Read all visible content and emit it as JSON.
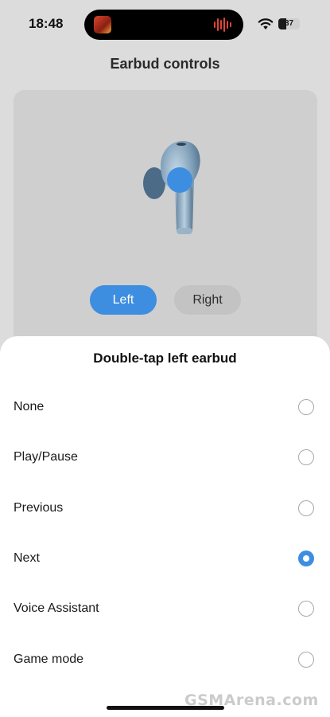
{
  "status_bar": {
    "time": "18:48",
    "battery_level": "37",
    "battery_fraction": 0.37,
    "icons": [
      "wifi-icon",
      "battery-icon"
    ],
    "live_activity": "now-playing"
  },
  "header": {
    "title": "Earbud controls"
  },
  "earbud_panel": {
    "image": "earbud-illustration",
    "tap_marker_color": "#3d8ee0",
    "segments": [
      {
        "label": "Left",
        "selected": true
      },
      {
        "label": "Right",
        "selected": false
      }
    ]
  },
  "sheet": {
    "title": "Double-tap left earbud",
    "options": [
      {
        "label": "None",
        "selected": false
      },
      {
        "label": "Play/Pause",
        "selected": false
      },
      {
        "label": "Previous",
        "selected": false
      },
      {
        "label": "Next",
        "selected": true
      },
      {
        "label": "Voice Assistant",
        "selected": false
      },
      {
        "label": "Game mode",
        "selected": false
      }
    ]
  },
  "colors": {
    "accent": "#3d8ee0",
    "sheet_bg": "#ffffff",
    "backdrop": "#dcdcdc"
  },
  "watermark": "GSMArena.com"
}
